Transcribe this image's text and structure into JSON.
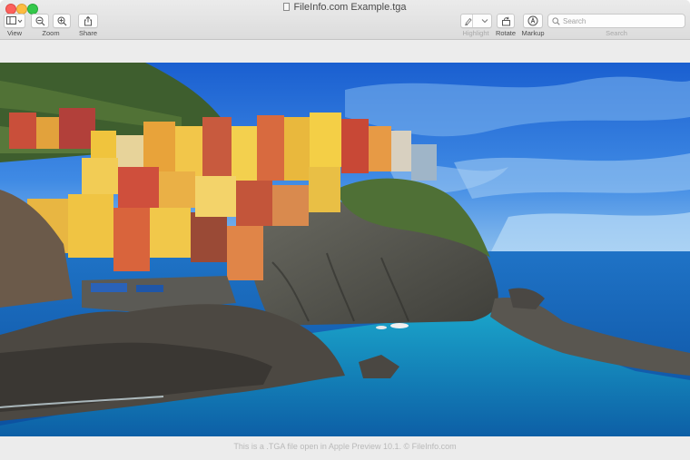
{
  "window": {
    "title": "FileInfo.com Example.tga"
  },
  "toolbar": {
    "view_label": "View",
    "zoom_label": "Zoom",
    "share_label": "Share",
    "highlight_label": "Highlight",
    "rotate_label": "Rotate",
    "markup_label": "Markup",
    "search_label": "Search",
    "search_placeholder": "Search",
    "search_value": ""
  },
  "icons": {
    "sidebar": "sidebar-icon",
    "zoom_out": "zoom-out-icon",
    "zoom_in": "zoom-in-icon",
    "share": "share-icon",
    "highlight": "highlighter-icon",
    "rotate": "rotate-icon",
    "markup": "markup-icon",
    "search": "search-icon"
  },
  "image": {
    "caption": "This is a .TGA file open in Apple Preview 10.1. © FileInfo.com"
  },
  "colors": {
    "close": "#fc605c",
    "minimize": "#fdbc40",
    "maximize": "#34c84a",
    "toolbar_bg": "#e3e3e3",
    "canvas_bg": "#ececec"
  }
}
